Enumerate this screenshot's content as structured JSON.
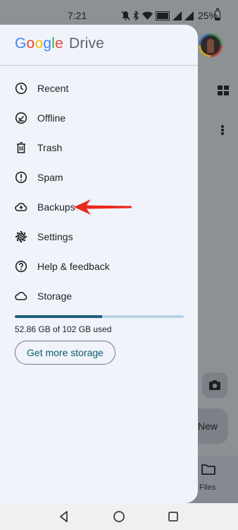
{
  "status_bar": {
    "time": "7:21",
    "battery_text": "25%",
    "icons": [
      "mute-icon",
      "bluetooth-icon",
      "wifi-icon",
      "volte-icon",
      "signal-icon",
      "signal-icon",
      "battery-icon"
    ]
  },
  "drawer": {
    "logo": {
      "google": [
        "G",
        "o",
        "o",
        "g",
        "l",
        "e"
      ],
      "product": "Drive"
    },
    "items": [
      {
        "label": "Recent",
        "icon": "clock-icon"
      },
      {
        "label": "Offline",
        "icon": "offline-icon"
      },
      {
        "label": "Trash",
        "icon": "trash-icon"
      },
      {
        "label": "Spam",
        "icon": "spam-icon"
      },
      {
        "label": "Backups",
        "icon": "backup-icon"
      },
      {
        "label": "Settings",
        "icon": "gear-icon"
      },
      {
        "label": "Help & feedback",
        "icon": "help-icon"
      },
      {
        "label": "Storage",
        "icon": "cloud-icon"
      }
    ],
    "storage": {
      "used_text": "52.86 GB of 102 GB used",
      "used_fraction": 0.518,
      "button_label": "Get more storage"
    }
  },
  "background": {
    "fab_label": "New",
    "bottom_nav_files": "Files"
  },
  "colors": {
    "drawer_bg": "#f0f4fa",
    "storage_fill": "#1e5d7c",
    "storage_track": "#b9d3e6",
    "button_text": "#0b5a6b",
    "arrow": "#e8291c",
    "google_blue": "#4285f4",
    "google_red": "#ea4335",
    "google_yellow": "#fbbc05",
    "google_green": "#34a853"
  }
}
